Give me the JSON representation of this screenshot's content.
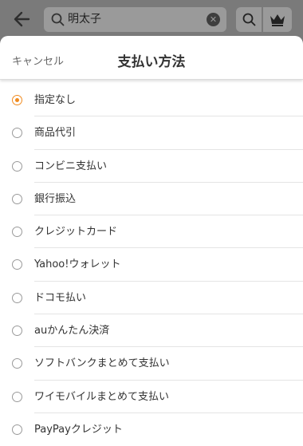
{
  "search": {
    "query": "明太子"
  },
  "sheet": {
    "cancel_label": "キャンセル",
    "title": "支払い方法"
  },
  "options": [
    {
      "label": "指定なし",
      "selected": true
    },
    {
      "label": "商品代引",
      "selected": false
    },
    {
      "label": "コンビニ支払い",
      "selected": false
    },
    {
      "label": "銀行振込",
      "selected": false
    },
    {
      "label": "クレジットカード",
      "selected": false
    },
    {
      "label": "Yahoo!ウォレット",
      "selected": false
    },
    {
      "label": "ドコモ払い",
      "selected": false
    },
    {
      "label": "auかんたん決済",
      "selected": false
    },
    {
      "label": "ソフトバンクまとめて支払い",
      "selected": false
    },
    {
      "label": "ワイモバイルまとめて支払い",
      "selected": false
    },
    {
      "label": "PayPayクレジット",
      "selected": false
    }
  ],
  "colors": {
    "accent": "#f08a1e",
    "overlay": "#7a7a7a"
  },
  "icons": [
    "back-arrow-icon",
    "search-icon",
    "clear-icon",
    "crown-icon"
  ]
}
